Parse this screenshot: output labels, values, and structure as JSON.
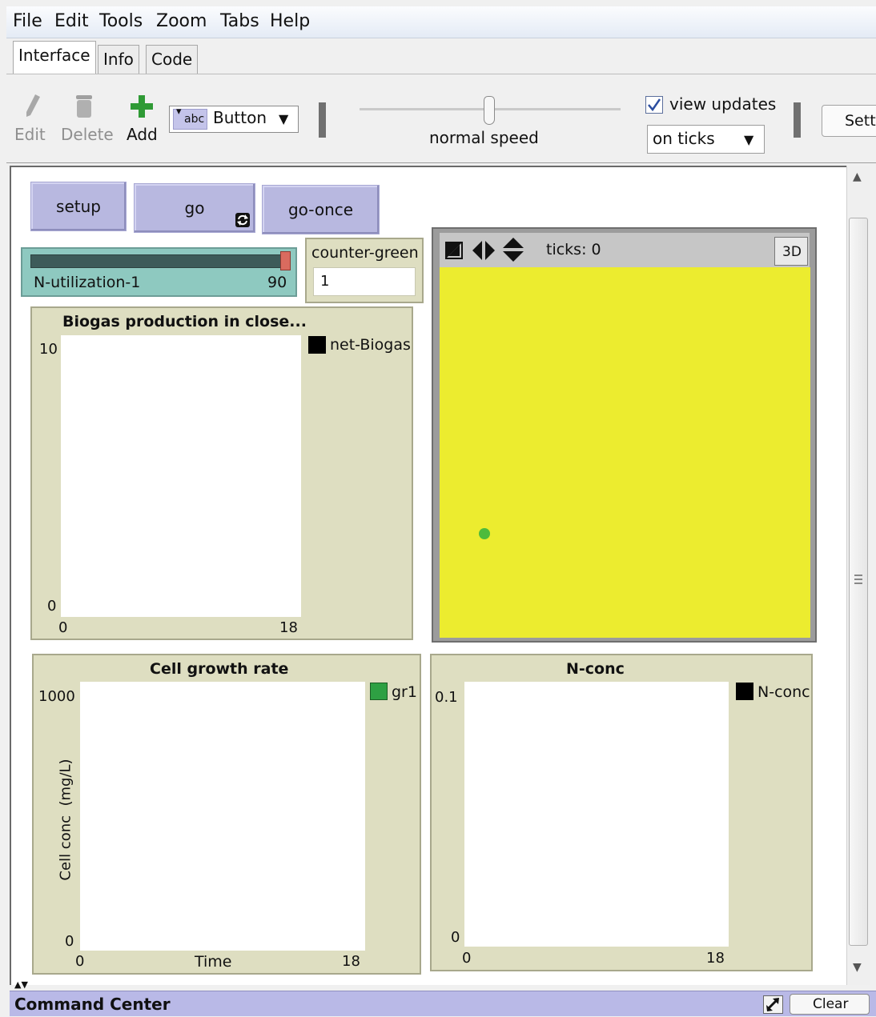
{
  "menu": [
    "File",
    "Edit",
    "Tools",
    "Zoom",
    "Tabs",
    "Help"
  ],
  "tabs": [
    "Interface",
    "Info",
    "Code"
  ],
  "toolbar": {
    "edit": "Edit",
    "delete": "Delete",
    "add": "Add",
    "widget_icon_text": "abc",
    "widget_type": "Button",
    "speed_label": "normal speed",
    "view_updates_label": "view updates",
    "view_updates_checked": true,
    "update_mode": "on ticks",
    "settings_label": "Sett"
  },
  "buttons": {
    "setup": "setup",
    "go": "go",
    "go_once": "go-once"
  },
  "slider": {
    "name": "N-utilization-1",
    "value": "90"
  },
  "input": {
    "label": "counter-green",
    "value": "1"
  },
  "world": {
    "ticks_label": "ticks: 0",
    "btn_3d": "3D",
    "background_color": "#ecec2f",
    "turtle_color": "#4dbb3c"
  },
  "plots": {
    "biogas": {
      "title": "Biogas production in close...",
      "ymax": "10",
      "ymin": "0",
      "xmin": "0",
      "xmax": "18",
      "legend": "net-Biogas",
      "legend_color": "#000000"
    },
    "growth": {
      "title": "Cell growth rate",
      "ymax": "1000",
      "ymin": "0",
      "xmin": "0",
      "xmax": "18",
      "xlabel": "Time",
      "ylabel": "Cell conc  (mg/L)",
      "legend": "gr1",
      "legend_color": "#2ea043"
    },
    "nconc": {
      "title": "N-conc",
      "ymax": "0.1",
      "ymin": "0",
      "xmin": "0",
      "xmax": "18",
      "legend": "N-conc",
      "legend_color": "#000000"
    }
  },
  "command_center": {
    "title": "Command Center",
    "clear": "Clear"
  }
}
